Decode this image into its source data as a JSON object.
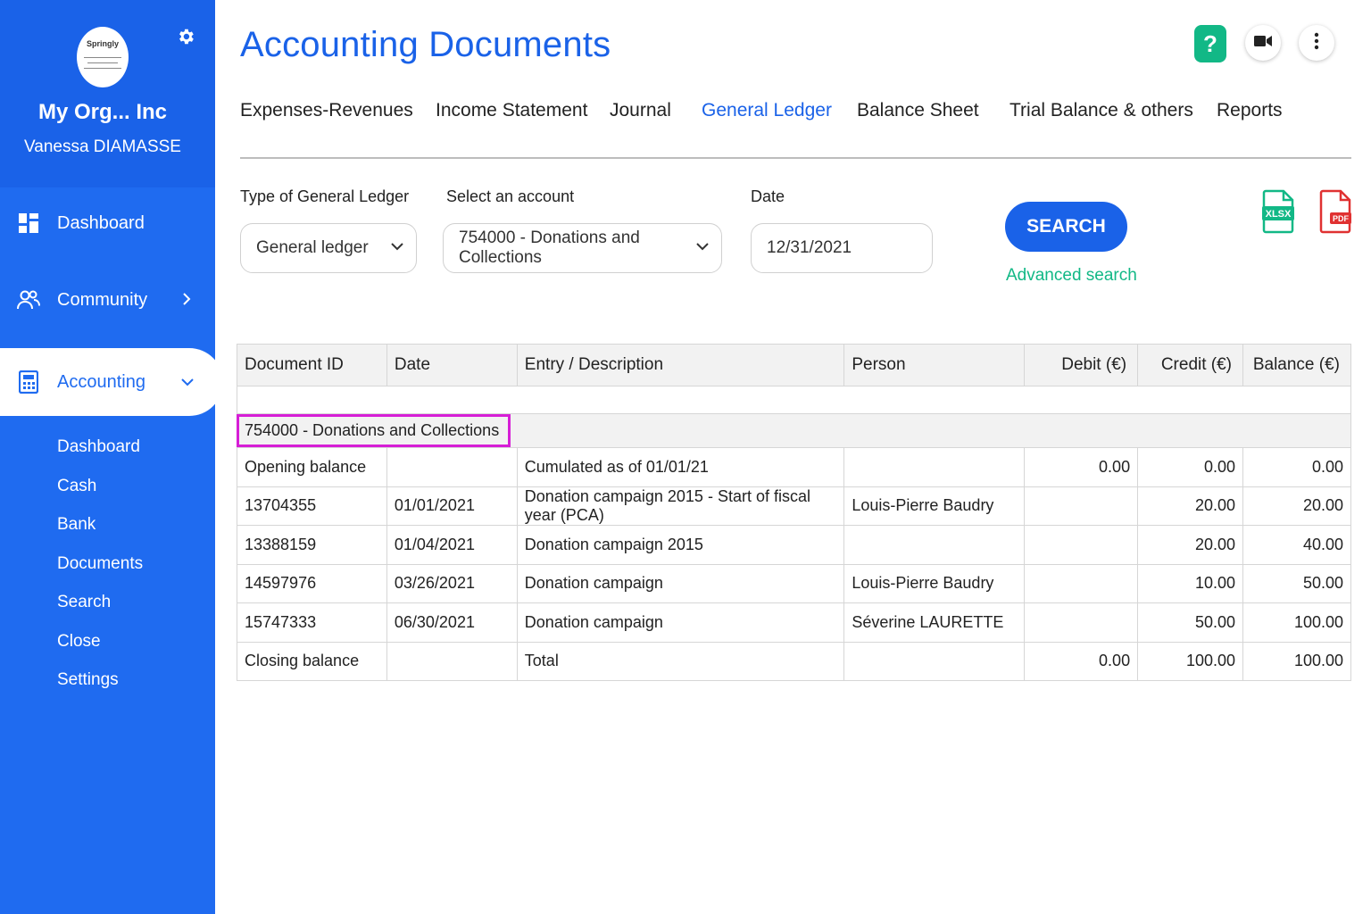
{
  "sidebar": {
    "logo_text": "Springly",
    "org_name": "My Org... Inc",
    "user_name": "Vanessa DIAMASSE",
    "nav": [
      {
        "label": "Dashboard",
        "icon": "dashboard-icon"
      },
      {
        "label": "Community",
        "icon": "community-icon"
      },
      {
        "label": "Accounting",
        "icon": "calculator-icon"
      }
    ],
    "subnav": [
      "Dashboard",
      "Cash",
      "Bank",
      "Documents",
      "Search",
      "Close",
      "Settings"
    ]
  },
  "header": {
    "title": "Accounting Documents",
    "help_label": "?"
  },
  "tabs": [
    {
      "label": "Expenses-Revenues",
      "active": false
    },
    {
      "label": "Income Statement",
      "active": false
    },
    {
      "label": "Journal",
      "active": false
    },
    {
      "label": "General Ledger",
      "active": true
    },
    {
      "label": "Balance Sheet",
      "active": false
    },
    {
      "label": "Trial Balance & others",
      "active": false
    },
    {
      "label": "Reports",
      "active": false
    }
  ],
  "filters": {
    "type_label": "Type of General Ledger",
    "type_value": "General ledger",
    "account_label": "Select an account",
    "account_value": "754000 - Donations and Collections",
    "date_label": "Date",
    "date_value": "12/31/2021",
    "search_label": "SEARCH",
    "advanced_label": "Advanced search"
  },
  "exports": {
    "xlsx_label": "XLSX",
    "pdf_label": "PDF"
  },
  "table": {
    "headers": [
      "Document ID",
      "Date",
      "Entry / Description",
      "Person",
      "Debit (€)",
      "Credit (€)",
      "Balance (€)"
    ],
    "group": "754000 - Donations and Collections",
    "rows": [
      [
        "Opening balance",
        "",
        "Cumulated as of 01/01/21",
        "",
        "0.00",
        "0.00",
        "0.00"
      ],
      [
        "13704355",
        "01/01/2021",
        "Donation campaign 2015 - Start of fiscal year (PCA)",
        "Louis-Pierre Baudry",
        "",
        "20.00",
        "20.00"
      ],
      [
        "13388159",
        "01/04/2021",
        "Donation campaign 2015",
        "",
        "",
        "20.00",
        "40.00"
      ],
      [
        "14597976",
        "03/26/2021",
        "Donation campaign",
        "Louis-Pierre Baudry",
        "",
        "10.00",
        "50.00"
      ],
      [
        "15747333",
        "06/30/2021",
        "Donation campaign",
        "Séverine LAURETTE",
        "",
        "50.00",
        "100.00"
      ],
      [
        "Closing balance",
        "",
        "Total",
        "",
        "0.00",
        "100.00",
        "100.00"
      ]
    ]
  },
  "colors": {
    "primary": "#1f6bf0",
    "accent_green": "#12b886",
    "highlight": "#d61ed6"
  }
}
